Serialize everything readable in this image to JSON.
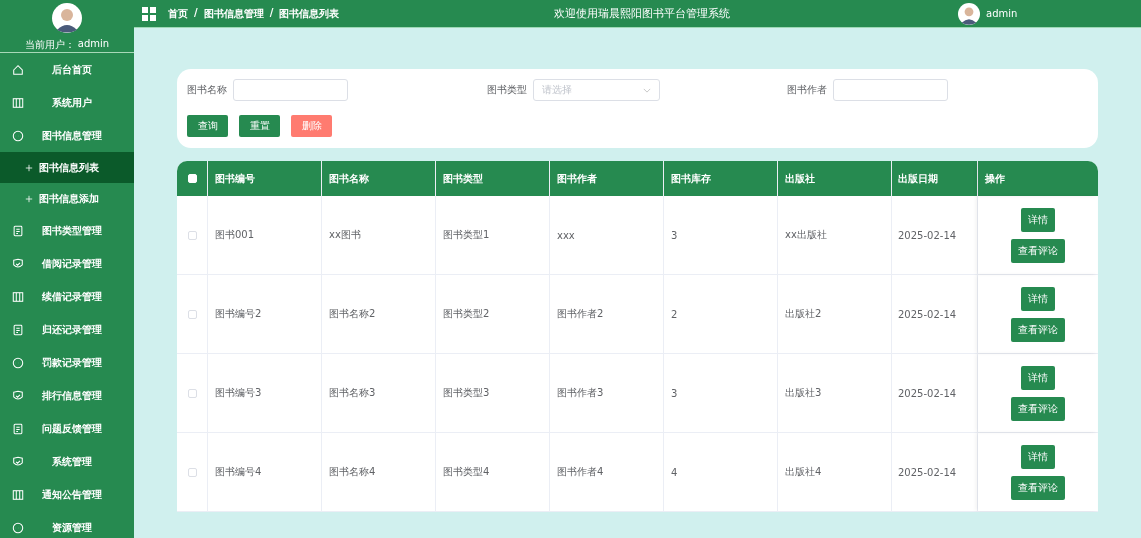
{
  "sidebar": {
    "user_label": "当前用户：",
    "username": "admin",
    "items": [
      {
        "label": "后台首页",
        "kind": "home",
        "selected": false
      },
      {
        "label": "系统用户",
        "kind": "columns",
        "selected": false
      },
      {
        "label": "图书信息管理",
        "kind": "chat",
        "selected": false,
        "expanded": true,
        "children": [
          {
            "label": "图书信息列表",
            "selected": true
          },
          {
            "label": "图书信息添加",
            "selected": false
          }
        ]
      },
      {
        "label": "图书类型管理",
        "kind": "doc",
        "selected": false
      },
      {
        "label": "借阅记录管理",
        "kind": "shield",
        "selected": false
      },
      {
        "label": "续借记录管理",
        "kind": "columns",
        "selected": false
      },
      {
        "label": "归还记录管理",
        "kind": "doc",
        "selected": false
      },
      {
        "label": "罚款记录管理",
        "kind": "chat",
        "selected": false
      },
      {
        "label": "排行信息管理",
        "kind": "shield",
        "selected": false
      },
      {
        "label": "问题反馈管理",
        "kind": "doc",
        "selected": false
      },
      {
        "label": "系统管理",
        "kind": "shield",
        "selected": false
      },
      {
        "label": "通知公告管理",
        "kind": "columns",
        "selected": false
      },
      {
        "label": "资源管理",
        "kind": "chat",
        "selected": false
      }
    ]
  },
  "header": {
    "breadcrumb": [
      "首页",
      "图书信息管理",
      "图书信息列表"
    ],
    "separator": "/",
    "title": "欢迎使用瑞晨熙阳图书平台管理系统",
    "username": "admin"
  },
  "search": {
    "fields": [
      {
        "label": "图书名称",
        "kind": "input"
      },
      {
        "label": "图书类型",
        "kind": "select",
        "placeholder": "请选择"
      },
      {
        "label": "图书作者",
        "kind": "input"
      }
    ],
    "buttons": [
      {
        "label": "查询",
        "kind": "primary"
      },
      {
        "label": "重置",
        "kind": "primary"
      },
      {
        "label": "删除",
        "kind": "danger"
      }
    ]
  },
  "table": {
    "select_all_checked": false,
    "columns": [
      "图书编号",
      "图书名称",
      "图书类型",
      "图书作者",
      "图书库存",
      "出版社",
      "出版日期",
      "操作"
    ],
    "rows": [
      {
        "checked": false,
        "cells": [
          "图书001",
          "xx图书",
          "图书类型1",
          "xxx",
          "3",
          "xx出版社",
          "2025-02-14"
        ],
        "actions": [
          "详情",
          "查看评论"
        ]
      },
      {
        "checked": false,
        "cells": [
          "图书编号2",
          "图书名称2",
          "图书类型2",
          "图书作者2",
          "2",
          "出版社2",
          "2025-02-14"
        ],
        "actions": [
          "详情",
          "查看评论"
        ]
      },
      {
        "checked": false,
        "cells": [
          "图书编号3",
          "图书名称3",
          "图书类型3",
          "图书作者3",
          "3",
          "出版社3",
          "2025-02-14"
        ],
        "actions": [
          "详情",
          "查看评论"
        ]
      },
      {
        "checked": false,
        "cells": [
          "图书编号4",
          "图书名称4",
          "图书类型4",
          "图书作者4",
          "4",
          "出版社4",
          "2025-02-14"
        ],
        "actions": [
          "详情",
          "查看评论"
        ]
      }
    ]
  }
}
